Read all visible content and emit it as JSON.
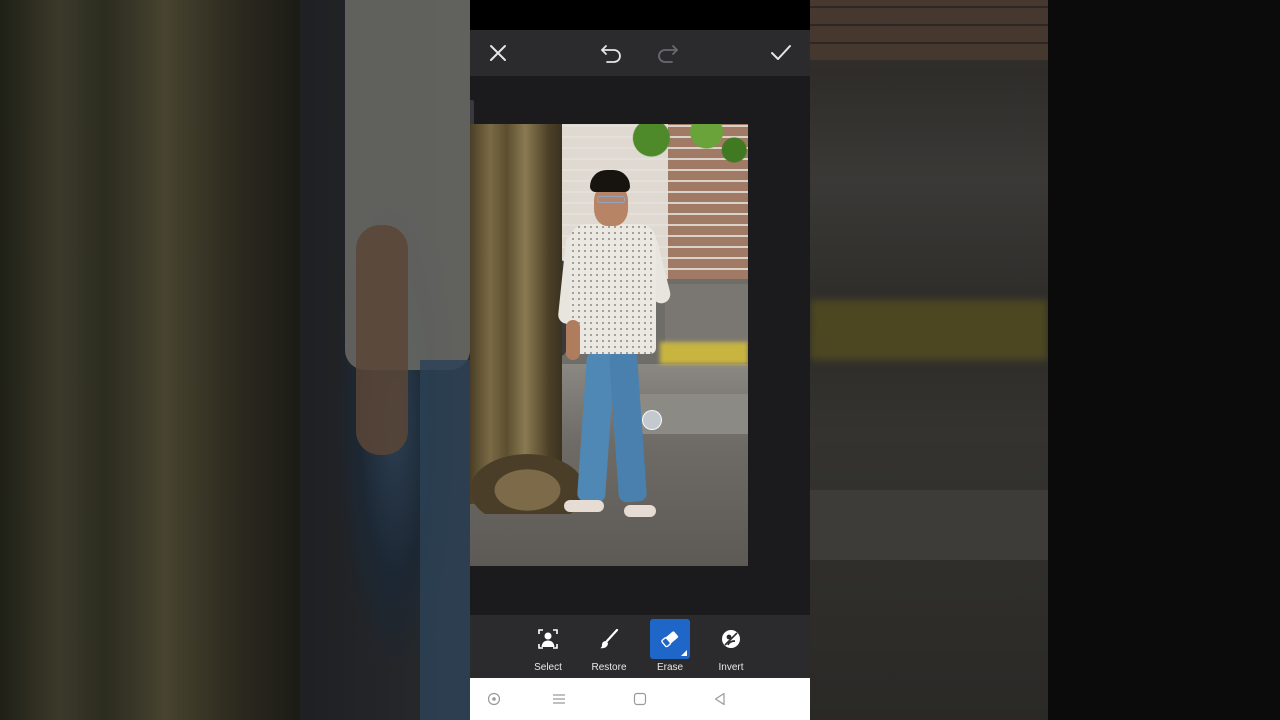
{
  "app": {
    "toolbar": {
      "close_icon": "close-icon",
      "undo_icon": "undo-icon",
      "redo_icon": "redo-icon",
      "apply_icon": "checkmark-icon"
    },
    "tools": [
      {
        "label": "Select",
        "icon": "select-person-icon",
        "active": false
      },
      {
        "label": "Restore",
        "icon": "brush-icon",
        "active": false
      },
      {
        "label": "Erase",
        "icon": "eraser-icon",
        "active": true
      },
      {
        "label": "Invert",
        "icon": "invert-icon",
        "active": false
      }
    ],
    "colors": {
      "accent": "#1f66c9",
      "toolbar_bg": "#2b2b2e",
      "canvas_bg": "#1b1b1d"
    },
    "navbar": {
      "icons": [
        "assistant-icon",
        "menu-icon",
        "home-icon",
        "back-icon"
      ]
    }
  }
}
